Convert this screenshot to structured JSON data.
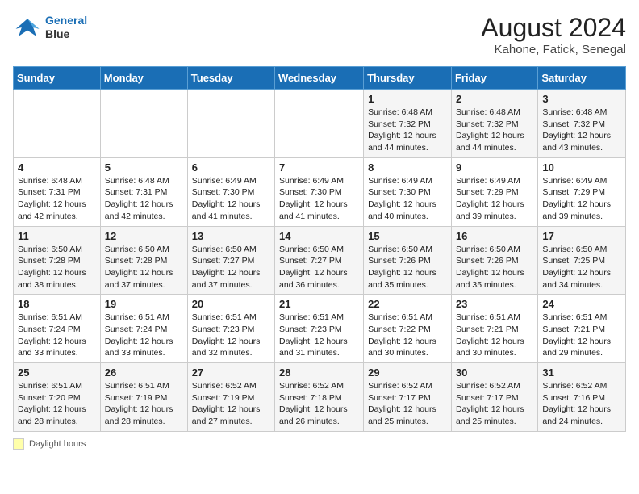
{
  "header": {
    "logo_line1": "General",
    "logo_line2": "Blue",
    "month_year": "August 2024",
    "location": "Kahone, Fatick, Senegal"
  },
  "days_of_week": [
    "Sunday",
    "Monday",
    "Tuesday",
    "Wednesday",
    "Thursday",
    "Friday",
    "Saturday"
  ],
  "footer": {
    "label": "Daylight hours"
  },
  "weeks": [
    [
      {
        "day": "",
        "info": ""
      },
      {
        "day": "",
        "info": ""
      },
      {
        "day": "",
        "info": ""
      },
      {
        "day": "",
        "info": ""
      },
      {
        "day": "1",
        "info": "Sunrise: 6:48 AM\nSunset: 7:32 PM\nDaylight: 12 hours\nand 44 minutes."
      },
      {
        "day": "2",
        "info": "Sunrise: 6:48 AM\nSunset: 7:32 PM\nDaylight: 12 hours\nand 44 minutes."
      },
      {
        "day": "3",
        "info": "Sunrise: 6:48 AM\nSunset: 7:32 PM\nDaylight: 12 hours\nand 43 minutes."
      }
    ],
    [
      {
        "day": "4",
        "info": "Sunrise: 6:48 AM\nSunset: 7:31 PM\nDaylight: 12 hours\nand 42 minutes."
      },
      {
        "day": "5",
        "info": "Sunrise: 6:48 AM\nSunset: 7:31 PM\nDaylight: 12 hours\nand 42 minutes."
      },
      {
        "day": "6",
        "info": "Sunrise: 6:49 AM\nSunset: 7:30 PM\nDaylight: 12 hours\nand 41 minutes."
      },
      {
        "day": "7",
        "info": "Sunrise: 6:49 AM\nSunset: 7:30 PM\nDaylight: 12 hours\nand 41 minutes."
      },
      {
        "day": "8",
        "info": "Sunrise: 6:49 AM\nSunset: 7:30 PM\nDaylight: 12 hours\nand 40 minutes."
      },
      {
        "day": "9",
        "info": "Sunrise: 6:49 AM\nSunset: 7:29 PM\nDaylight: 12 hours\nand 39 minutes."
      },
      {
        "day": "10",
        "info": "Sunrise: 6:49 AM\nSunset: 7:29 PM\nDaylight: 12 hours\nand 39 minutes."
      }
    ],
    [
      {
        "day": "11",
        "info": "Sunrise: 6:50 AM\nSunset: 7:28 PM\nDaylight: 12 hours\nand 38 minutes."
      },
      {
        "day": "12",
        "info": "Sunrise: 6:50 AM\nSunset: 7:28 PM\nDaylight: 12 hours\nand 37 minutes."
      },
      {
        "day": "13",
        "info": "Sunrise: 6:50 AM\nSunset: 7:27 PM\nDaylight: 12 hours\nand 37 minutes."
      },
      {
        "day": "14",
        "info": "Sunrise: 6:50 AM\nSunset: 7:27 PM\nDaylight: 12 hours\nand 36 minutes."
      },
      {
        "day": "15",
        "info": "Sunrise: 6:50 AM\nSunset: 7:26 PM\nDaylight: 12 hours\nand 35 minutes."
      },
      {
        "day": "16",
        "info": "Sunrise: 6:50 AM\nSunset: 7:26 PM\nDaylight: 12 hours\nand 35 minutes."
      },
      {
        "day": "17",
        "info": "Sunrise: 6:50 AM\nSunset: 7:25 PM\nDaylight: 12 hours\nand 34 minutes."
      }
    ],
    [
      {
        "day": "18",
        "info": "Sunrise: 6:51 AM\nSunset: 7:24 PM\nDaylight: 12 hours\nand 33 minutes."
      },
      {
        "day": "19",
        "info": "Sunrise: 6:51 AM\nSunset: 7:24 PM\nDaylight: 12 hours\nand 33 minutes."
      },
      {
        "day": "20",
        "info": "Sunrise: 6:51 AM\nSunset: 7:23 PM\nDaylight: 12 hours\nand 32 minutes."
      },
      {
        "day": "21",
        "info": "Sunrise: 6:51 AM\nSunset: 7:23 PM\nDaylight: 12 hours\nand 31 minutes."
      },
      {
        "day": "22",
        "info": "Sunrise: 6:51 AM\nSunset: 7:22 PM\nDaylight: 12 hours\nand 30 minutes."
      },
      {
        "day": "23",
        "info": "Sunrise: 6:51 AM\nSunset: 7:21 PM\nDaylight: 12 hours\nand 30 minutes."
      },
      {
        "day": "24",
        "info": "Sunrise: 6:51 AM\nSunset: 7:21 PM\nDaylight: 12 hours\nand 29 minutes."
      }
    ],
    [
      {
        "day": "25",
        "info": "Sunrise: 6:51 AM\nSunset: 7:20 PM\nDaylight: 12 hours\nand 28 minutes."
      },
      {
        "day": "26",
        "info": "Sunrise: 6:51 AM\nSunset: 7:19 PM\nDaylight: 12 hours\nand 28 minutes."
      },
      {
        "day": "27",
        "info": "Sunrise: 6:52 AM\nSunset: 7:19 PM\nDaylight: 12 hours\nand 27 minutes."
      },
      {
        "day": "28",
        "info": "Sunrise: 6:52 AM\nSunset: 7:18 PM\nDaylight: 12 hours\nand 26 minutes."
      },
      {
        "day": "29",
        "info": "Sunrise: 6:52 AM\nSunset: 7:17 PM\nDaylight: 12 hours\nand 25 minutes."
      },
      {
        "day": "30",
        "info": "Sunrise: 6:52 AM\nSunset: 7:17 PM\nDaylight: 12 hours\nand 25 minutes."
      },
      {
        "day": "31",
        "info": "Sunrise: 6:52 AM\nSunset: 7:16 PM\nDaylight: 12 hours\nand 24 minutes."
      }
    ]
  ]
}
